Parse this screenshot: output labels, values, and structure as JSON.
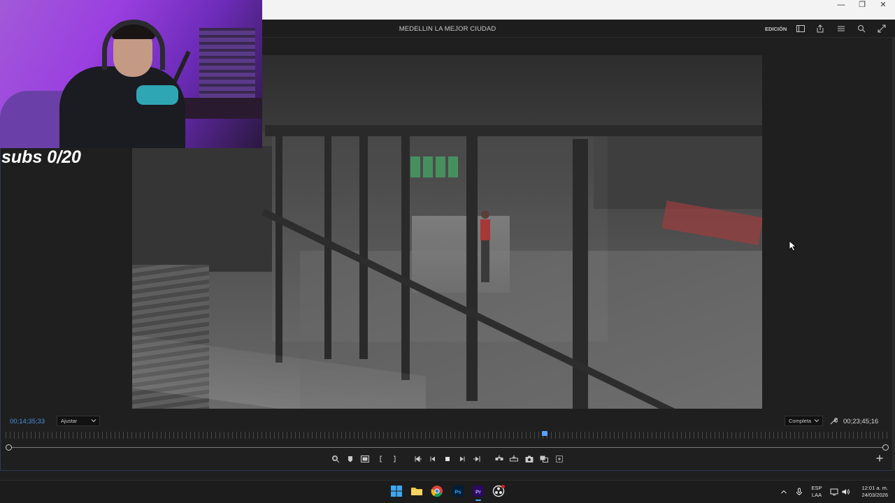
{
  "window": {
    "minimize_label": "—",
    "restore_label": "❐",
    "close_label": "✕"
  },
  "header": {
    "sequence_title": "MEDELLIN LA MEJOR CIUDAD",
    "workspace_label": "EDICIÓN"
  },
  "overlay": {
    "subs_text": "subs 0/20"
  },
  "monitor": {
    "current_timecode": "00;14;35;33",
    "fit_option": "Ajustar",
    "resolution_option": "Completa",
    "duration_timecode": "00;23;45;16",
    "playhead_fraction": 0.61
  },
  "taskbar": {
    "apps": [
      "windows-start",
      "file-explorer",
      "chrome",
      "photoshop",
      "premiere-pro",
      "obs-studio"
    ],
    "lang_line1": "ESP",
    "lang_line2": "LAA",
    "time": "12:01 a. m.",
    "date": "24/03/2026"
  },
  "colors": {
    "accent_blue": "#4a90e2",
    "panel_bg": "#1f1f1f",
    "taskbar_bg": "#1c1c1c",
    "premiere_purple": "#2a0a5e"
  }
}
